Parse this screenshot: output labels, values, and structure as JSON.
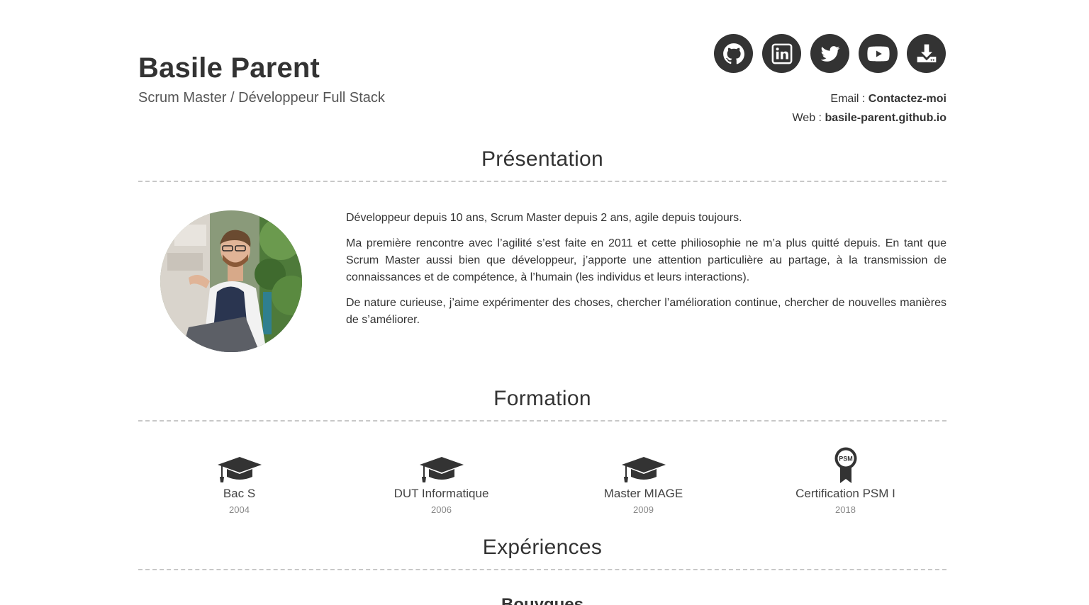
{
  "header": {
    "name": "Basile Parent",
    "role": "Scrum Master / Développeur Full Stack",
    "email_label": "Email : ",
    "email_value": "Contactez-moi",
    "web_label": "Web : ",
    "web_value": "basile-parent.github.io"
  },
  "socials": [
    {
      "icon": "github-icon"
    },
    {
      "icon": "linkedin-icon"
    },
    {
      "icon": "twitter-icon"
    },
    {
      "icon": "youtube-icon"
    },
    {
      "icon": "download-icon"
    }
  ],
  "presentation": {
    "title": "Présentation",
    "paragraphs": [
      "Développeur depuis 10 ans, Scrum Master depuis 2 ans, agile depuis toujours.",
      "Ma première rencontre avec l’agilité s’est faite en 2011 et cette philiosophie ne m’a plus quitté depuis. En tant que Scrum Master aussi bien que développeur, j’apporte une attention particulière au partage, à la transmission de connaissances et de compétence, à l’humain (les individus et leurs interactions).",
      "De nature curieuse, j’aime expérimenter des choses, chercher l’amélioration continue, chercher de nouvelles manières de s’améliorer."
    ]
  },
  "formation": {
    "title": "Formation",
    "items": [
      {
        "label": "Bac S",
        "year": "2004",
        "icon": "graduation-cap-icon"
      },
      {
        "label": "DUT Informatique",
        "year": "2006",
        "icon": "graduation-cap-icon"
      },
      {
        "label": "Master MIAGE",
        "year": "2009",
        "icon": "graduation-cap-icon"
      },
      {
        "label": "Certification PSM I",
        "year": "2018",
        "icon": "psm-badge-icon",
        "badge_text": "PSM"
      }
    ]
  },
  "experiences": {
    "title": "Expériences",
    "first_entry_partial": "Bouygues"
  },
  "colors": {
    "text": "#333333",
    "divider": "#c8c8c8",
    "icon_bg": "#333333"
  }
}
